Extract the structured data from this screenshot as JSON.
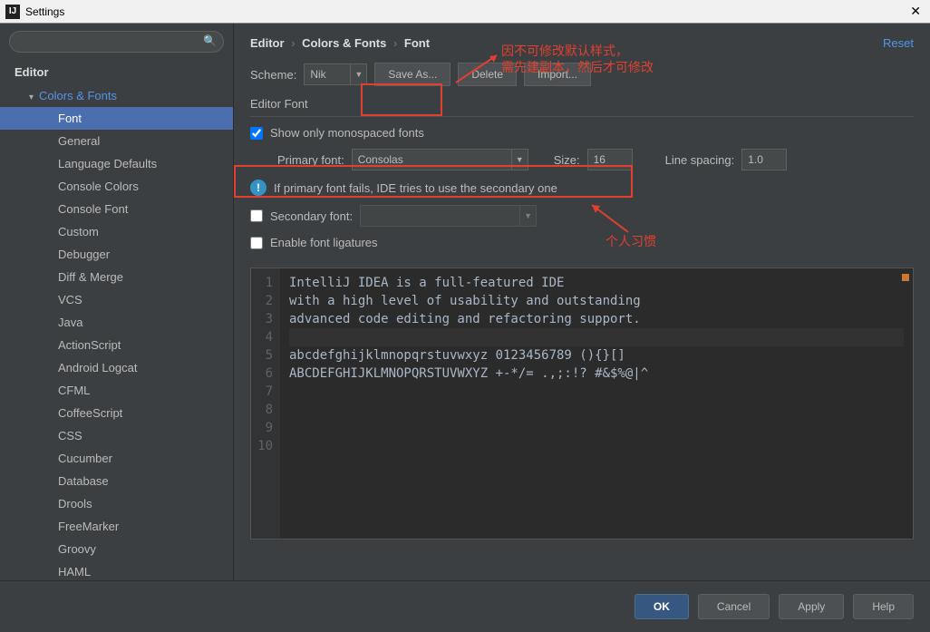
{
  "window": {
    "title": "Settings"
  },
  "search": {
    "placeholder": ""
  },
  "breadcrumb": {
    "a": "Editor",
    "b": "Colors & Fonts",
    "c": "Font"
  },
  "reset_label": "Reset",
  "sidebar": {
    "header": "Editor",
    "group": "Colors & Fonts",
    "items": [
      "Font",
      "General",
      "Language Defaults",
      "Console Colors",
      "Console Font",
      "Custom",
      "Debugger",
      "Diff & Merge",
      "VCS",
      "Java",
      "ActionScript",
      "Android Logcat",
      "CFML",
      "CoffeeScript",
      "CSS",
      "Cucumber",
      "Database",
      "Drools",
      "FreeMarker",
      "Groovy",
      "HAML"
    ]
  },
  "scheme": {
    "label": "Scheme:",
    "value": "Nik",
    "save_as": "Save As...",
    "delete": "Delete",
    "import": "Import..."
  },
  "editor_font": {
    "title": "Editor Font",
    "show_mono": "Show only monospaced fonts",
    "primary_label": "Primary font:",
    "primary_value": "Consolas",
    "size_label": "Size:",
    "size_value": "16",
    "spacing_label": "Line spacing:",
    "spacing_value": "1.0",
    "info": "If primary font fails, IDE tries to use the secondary one",
    "secondary_label": "Secondary font:",
    "secondary_value": "",
    "ligatures": "Enable font ligatures"
  },
  "preview": {
    "lines": [
      "IntelliJ IDEA is a full-featured IDE",
      "with a high level of usability and outstanding",
      "advanced code editing and refactoring support.",
      "",
      "abcdefghijklmnopqrstuvwxyz 0123456789 (){}[]",
      "ABCDEFGHIJKLMNOPQRSTUVWXYZ +-*/= .,;:!? #&$%@|^",
      "",
      "",
      "",
      ""
    ]
  },
  "footer": {
    "ok": "OK",
    "cancel": "Cancel",
    "apply": "Apply",
    "help": "Help"
  },
  "annotations": {
    "top1": "因不可修改默认样式，",
    "top2": "需先建副本，然后才可修改",
    "habit": "个人习惯"
  }
}
